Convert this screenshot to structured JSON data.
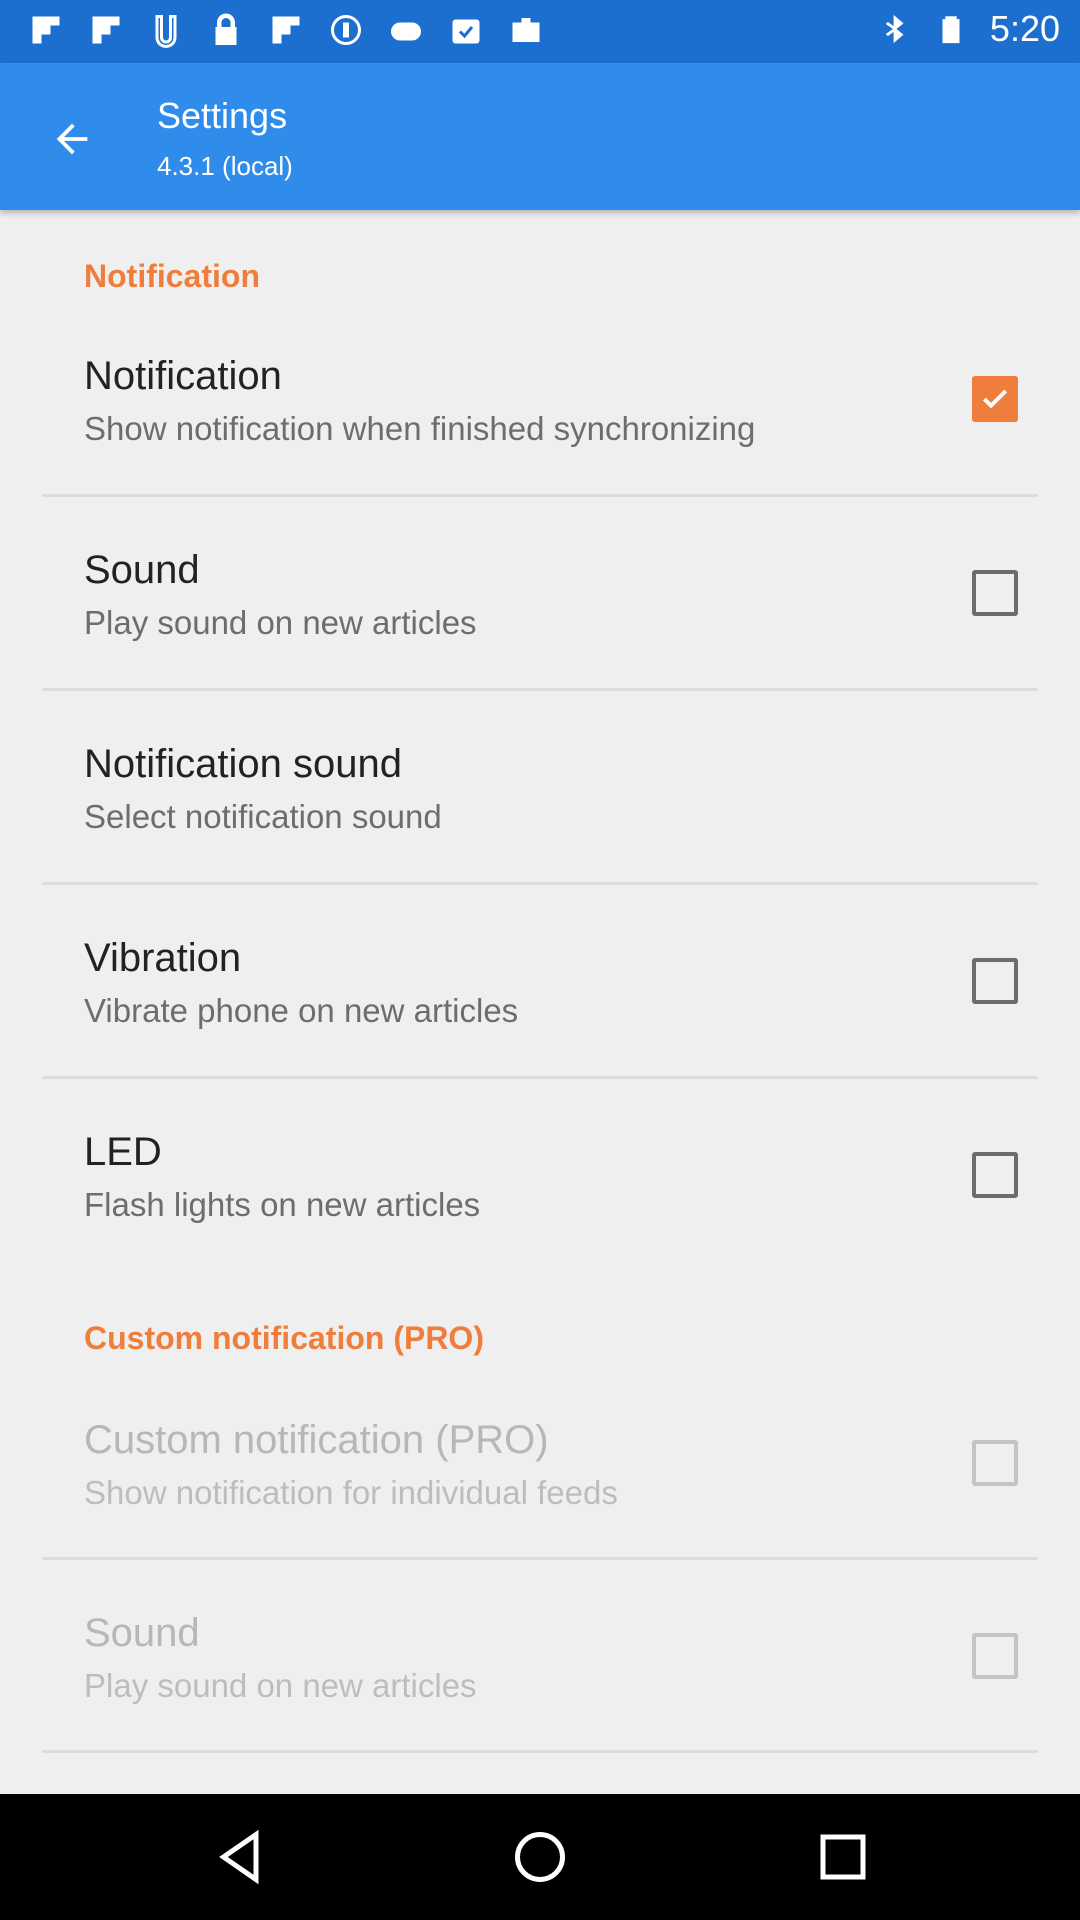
{
  "status_bar": {
    "time": "5:20",
    "icons": [
      "flipboard-icon",
      "flipboard-icon",
      "hangers-icon",
      "lock-icon",
      "flipboard-icon",
      "circle-icon",
      "gamepad-icon",
      "task-icon",
      "briefcase-icon"
    ],
    "right_icons": [
      "bluetooth-icon",
      "battery-icon"
    ]
  },
  "app_bar": {
    "title": "Settings",
    "subtitle": "4.3.1 (local)"
  },
  "sections": [
    {
      "header": "Notification",
      "items": [
        {
          "title": "Notification",
          "summary": "Show notification when finished synchronizing",
          "checkbox": true,
          "checked": true,
          "enabled": true
        },
        {
          "title": "Sound",
          "summary": "Play sound on new articles",
          "checkbox": true,
          "checked": false,
          "enabled": true
        },
        {
          "title": "Notification sound",
          "summary": "Select notification sound",
          "checkbox": false,
          "checked": false,
          "enabled": true
        },
        {
          "title": "Vibration",
          "summary": "Vibrate phone on new articles",
          "checkbox": true,
          "checked": false,
          "enabled": true
        },
        {
          "title": "LED",
          "summary": "Flash lights on new articles",
          "checkbox": true,
          "checked": false,
          "enabled": true
        }
      ]
    },
    {
      "header": "Custom notification (PRO)",
      "items": [
        {
          "title": "Custom notification (PRO)",
          "summary": "Show notification for individual feeds",
          "checkbox": true,
          "checked": false,
          "enabled": false
        },
        {
          "title": "Sound",
          "summary": "Play sound on new articles",
          "checkbox": true,
          "checked": false,
          "enabled": false
        }
      ]
    }
  ],
  "colors": {
    "status_bar": "#1c6fcf",
    "app_bar": "#2f8ceb",
    "accent": "#ef7d3c",
    "background": "#efefef"
  },
  "nav_bar": {
    "buttons": [
      "back-nav-icon",
      "home-nav-icon",
      "recents-nav-icon"
    ]
  }
}
